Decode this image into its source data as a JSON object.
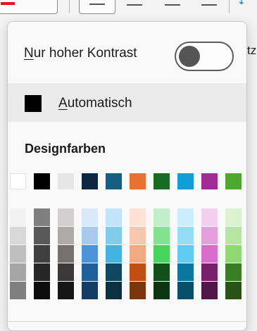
{
  "toolbar": {
    "side_text": "tz",
    "arrow_glyph": "↓"
  },
  "contrast": {
    "label_prefix": "N",
    "label_rest": "ur hoher Kontrast",
    "toggle_on": false
  },
  "automatic": {
    "label_prefix": "A",
    "label_rest": "utomatisch",
    "color": "#000000"
  },
  "section": {
    "title": "Designfarben"
  },
  "theme_colors": [
    "#ffffff",
    "#000000",
    "#e7e6e6",
    "#0e2841",
    "#156082",
    "#e97132",
    "#196b24",
    "#0f9ed5",
    "#a02b93",
    "#4ea72e"
  ],
  "shade_columns": [
    [
      "#f2f2f2",
      "#d8d8d8",
      "#bfbfbf",
      "#a5a5a5",
      "#7f7f7f"
    ],
    [
      "#7f7f7f",
      "#595959",
      "#3f3f3f",
      "#262626",
      "#0d0d0d"
    ],
    [
      "#d0cece",
      "#aeaaaa",
      "#757171",
      "#3a3838",
      "#171616"
    ],
    [
      "#dae9f8",
      "#a6c9ec",
      "#4d93d9",
      "#215f9a",
      "#153d64"
    ],
    [
      "#c0e4f5",
      "#83cbeb",
      "#44b3e1",
      "#0f4761",
      "#0b3040"
    ],
    [
      "#fbe2d5",
      "#f7c7ac",
      "#f1a983",
      "#c04f15",
      "#7c350e"
    ],
    [
      "#c1f0c8",
      "#83e28e",
      "#47d45a",
      "#124f1b",
      "#0c3512"
    ],
    [
      "#caeefb",
      "#94dcf8",
      "#61cbf4",
      "#0b769f",
      "#074f6a"
    ],
    [
      "#f2ceef",
      "#e59edd",
      "#d86dcd",
      "#77206d",
      "#501549"
    ],
    [
      "#daf2d0",
      "#b4e5a2",
      "#8ed973",
      "#3b7d23",
      "#275317"
    ]
  ]
}
